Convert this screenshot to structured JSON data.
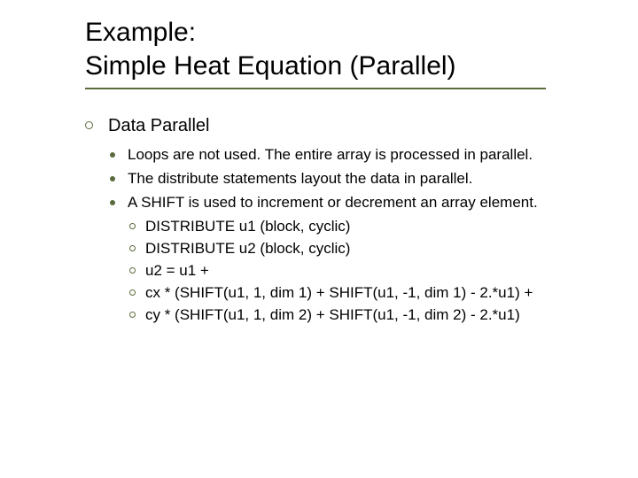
{
  "title_line1": "Example:",
  "title_line2": "Simple Heat Equation (Parallel)",
  "lvl1": {
    "item0": "Data Parallel"
  },
  "lvl2": {
    "item0": "Loops are not used. The entire array is processed in parallel.",
    "item1": "The distribute statements layout the data in parallel.",
    "item2": "A SHIFT is used to increment or decrement an array element."
  },
  "lvl3": {
    "item0": "DISTRIBUTE u1 (block, cyclic)",
    "item1": "DISTRIBUTE u2 (block, cyclic)",
    "item2": "u2 = u1 +",
    "item3": "cx * (SHIFT(u1, 1, dim 1) + SHIFT(u1, -1, dim 1) - 2.*u1) +",
    "item4": "cy * (SHIFT(u1, 1, dim 2) + SHIFT(u1, -1, dim 2) - 2.*u1)"
  }
}
